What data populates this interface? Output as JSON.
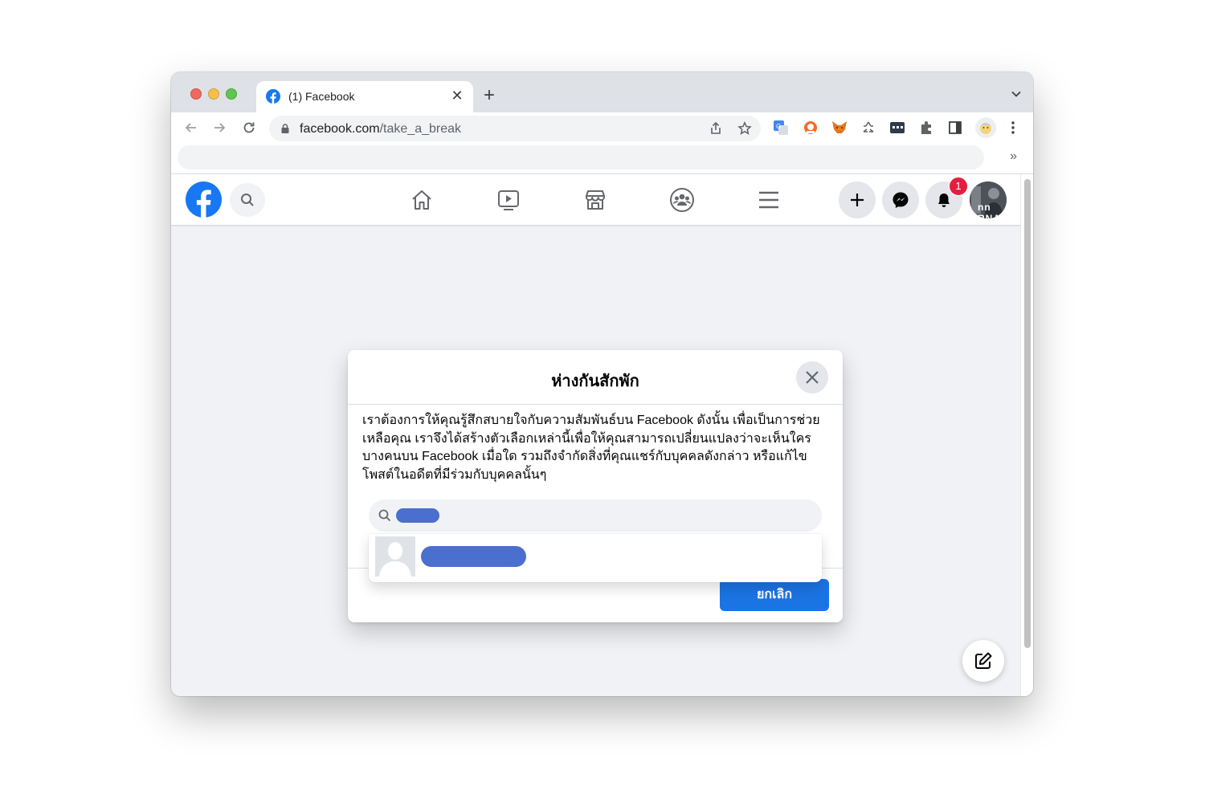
{
  "browser": {
    "tab": {
      "title": "(1) Facebook",
      "close": "✕"
    },
    "new_tab": "+",
    "address": {
      "domain": "facebook.com",
      "path": "/take_a_break"
    },
    "bookmarks_overflow": "»"
  },
  "facebook": {
    "notification_count": "1",
    "avatar_text": "nn RNA",
    "accent": "#1b74e4"
  },
  "modal": {
    "title": "ห่างกันสักพัก",
    "body": "เราต้องการให้คุณรู้สึกสบายใจกับความสัมพันธ์บน Facebook ดังนั้น เพื่อเป็นการช่วยเหลือคุณ เราจึงได้สร้างตัวเลือกเหล่านี้เพื่อให้คุณสามารถเปลี่ยนแปลงว่าจะเห็นใครบางคนบน Facebook เมื่อใด รวมถึงจำกัดสิ่งที่คุณแชร์กับบุคคลดังกล่าว หรือแก้ไขโพสต์ในอดีตที่มีร่วมกับบุคคลนั้นๆ",
    "cancel_label": "ยกเลิก"
  }
}
